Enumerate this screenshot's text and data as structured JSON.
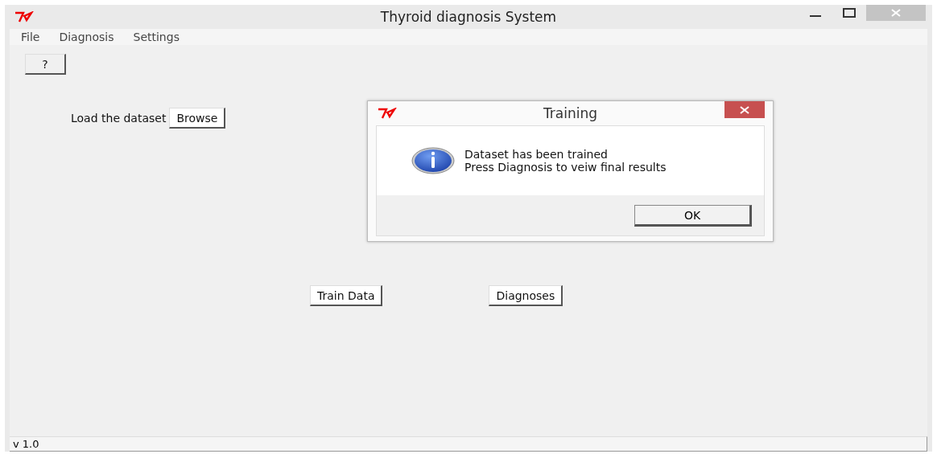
{
  "window": {
    "title": "Thyroid diagnosis System"
  },
  "menu": [
    "File",
    "Diagnosis",
    "Settings"
  ],
  "help_button": "?",
  "load_row": {
    "label": "Load the dataset",
    "button": "Browse"
  },
  "action_buttons": [
    "Train Data",
    "Diagnoses"
  ],
  "status_bar": "v 1.0",
  "dialog": {
    "title": "Training",
    "lines": [
      "Dataset has been trained",
      "Press Diagnosis to veiw final results"
    ],
    "button": "OK"
  }
}
